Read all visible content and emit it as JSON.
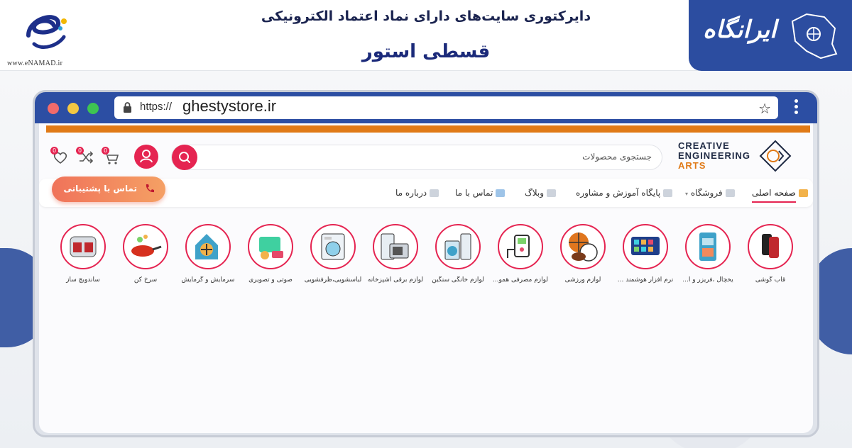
{
  "header": {
    "enamad_url": "www.eNAMAD.ir",
    "subtitle": "دایرکتوری سایت‌های دارای نماد اعتماد الکترونیکی",
    "title": "قسطی استور",
    "brand": "ایرانگاه"
  },
  "browser": {
    "url_prefix": "https://",
    "url_domain": "ghestystore.ir"
  },
  "site": {
    "logo_line1": "CREATIVE",
    "logo_line2": "ENGINEERING",
    "logo_line3": "ARTS",
    "search_placeholder": "جستجوی محصولات",
    "badges": {
      "wishlist": "0",
      "compare": "0",
      "cart": "0"
    },
    "support_label": "تماس با پشتیبانی",
    "nav": [
      {
        "label": "صفحه اصلی"
      },
      {
        "label": "فروشگاه"
      },
      {
        "label": "پایگاه آموزش و مشاوره"
      },
      {
        "label": "وبلاگ"
      },
      {
        "label": "تماس با ما"
      },
      {
        "label": "درباره ما"
      }
    ],
    "categories": [
      {
        "label": "قاب گوشی"
      },
      {
        "label": "یخچال ،فریزر و ا..."
      },
      {
        "label": "نرم افزار هوشمند ..."
      },
      {
        "label": "لوازم ورزشی"
      },
      {
        "label": "لوازم مصرفی همو..."
      },
      {
        "label": "لوازم خانگی سنگین"
      },
      {
        "label": "لوازم برقی آشپزخانه"
      },
      {
        "label": "لباسشویی،ظرفشویی"
      },
      {
        "label": "صوتی و تصویری"
      },
      {
        "label": "سرمایش و گرمایش"
      },
      {
        "label": "سرخ کن"
      },
      {
        "label": "ساندویچ ساز"
      }
    ]
  },
  "colors": {
    "accent": "#e52451",
    "brand_blue": "#2c4ea3",
    "orange": "#e07a17"
  }
}
